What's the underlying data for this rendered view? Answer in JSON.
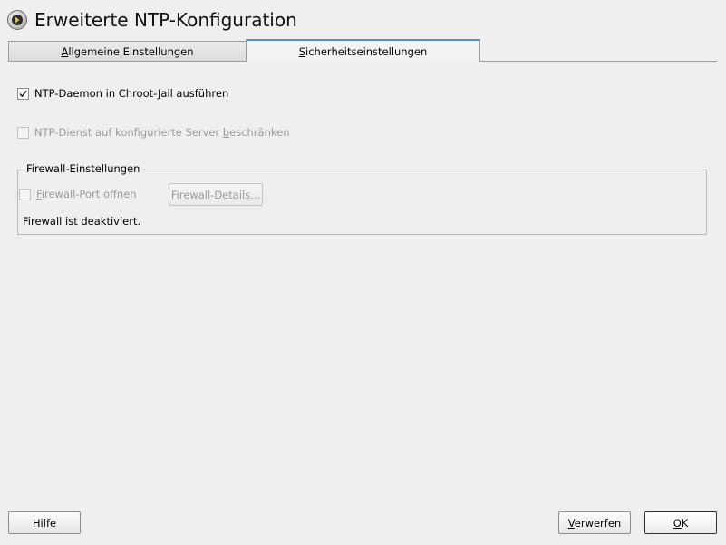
{
  "window": {
    "title": "Erweiterte NTP-Konfiguration",
    "icon": "yast-clock-arrow-icon"
  },
  "tabs": [
    {
      "pre": "",
      "accel": "A",
      "post": "llgemeine Einstellungen",
      "active": false
    },
    {
      "pre": "",
      "accel": "S",
      "post": "icherheitseinstellungen",
      "active": true
    }
  ],
  "security": {
    "chroot": {
      "pre": "NTP-Daemon in Chroot-",
      "accel": "J",
      "post": "ail ausführen",
      "checked": true,
      "enabled": true
    },
    "restrict": {
      "pre": "NTP-Dienst auf konfigurierte Server ",
      "accel": "b",
      "post": "eschränken",
      "checked": false,
      "enabled": false
    }
  },
  "firewall": {
    "group_title": "Firewall-Einstellungen",
    "open_port": {
      "pre": "",
      "accel": "F",
      "post": "irewall-Port öffnen",
      "checked": false,
      "enabled": false
    },
    "details_button": {
      "pre": "Firewall-",
      "accel": "D",
      "post": "etails...",
      "enabled": false
    },
    "status": "Firewall ist deaktiviert."
  },
  "buttons": {
    "help": "Hilfe",
    "cancel": {
      "pre": "",
      "accel": "V",
      "post": "erwerfen"
    },
    "ok": {
      "pre": "",
      "accel": "O",
      "post": "K"
    }
  },
  "colors": {
    "background": "#efefef",
    "active_tab_accent": "#5a8cc4",
    "disabled_text": "#9a9a9a"
  }
}
